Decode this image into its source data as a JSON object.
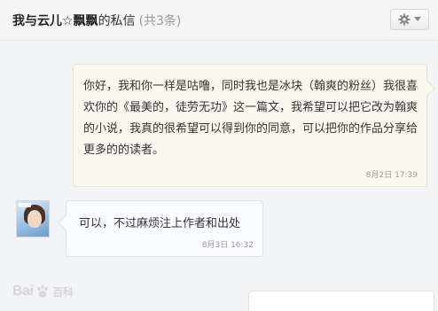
{
  "header": {
    "username": "我与云儿☆飘飘",
    "suffix": "的私信",
    "count": "(共3条)",
    "settings_icon": "gear-icon",
    "dropdown_icon": "chevron-down-icon"
  },
  "messages": [
    {
      "direction": "sent",
      "text": "你好，我和你一样是咕噜，同时我也是冰块（翰爽的粉丝）我很喜欢你的《最美的，徒劳无功》这一篇文，我希望可以把它改为翰爽的小说，我真的很希望可以得到你的同意，可以把你的作品分享给更多的的读者。",
      "time": "8月2日 17:39"
    },
    {
      "direction": "received",
      "text": "可以，不过麻烦注上作者和出处",
      "time": "8月3日 16:32"
    }
  ],
  "watermark": {
    "latin": "Bai",
    "cn": "百科"
  },
  "colors": {
    "sent_bg": "#fbf8ef",
    "received_bg": "#fbfcff",
    "page_bg": "#f3f4f6"
  }
}
